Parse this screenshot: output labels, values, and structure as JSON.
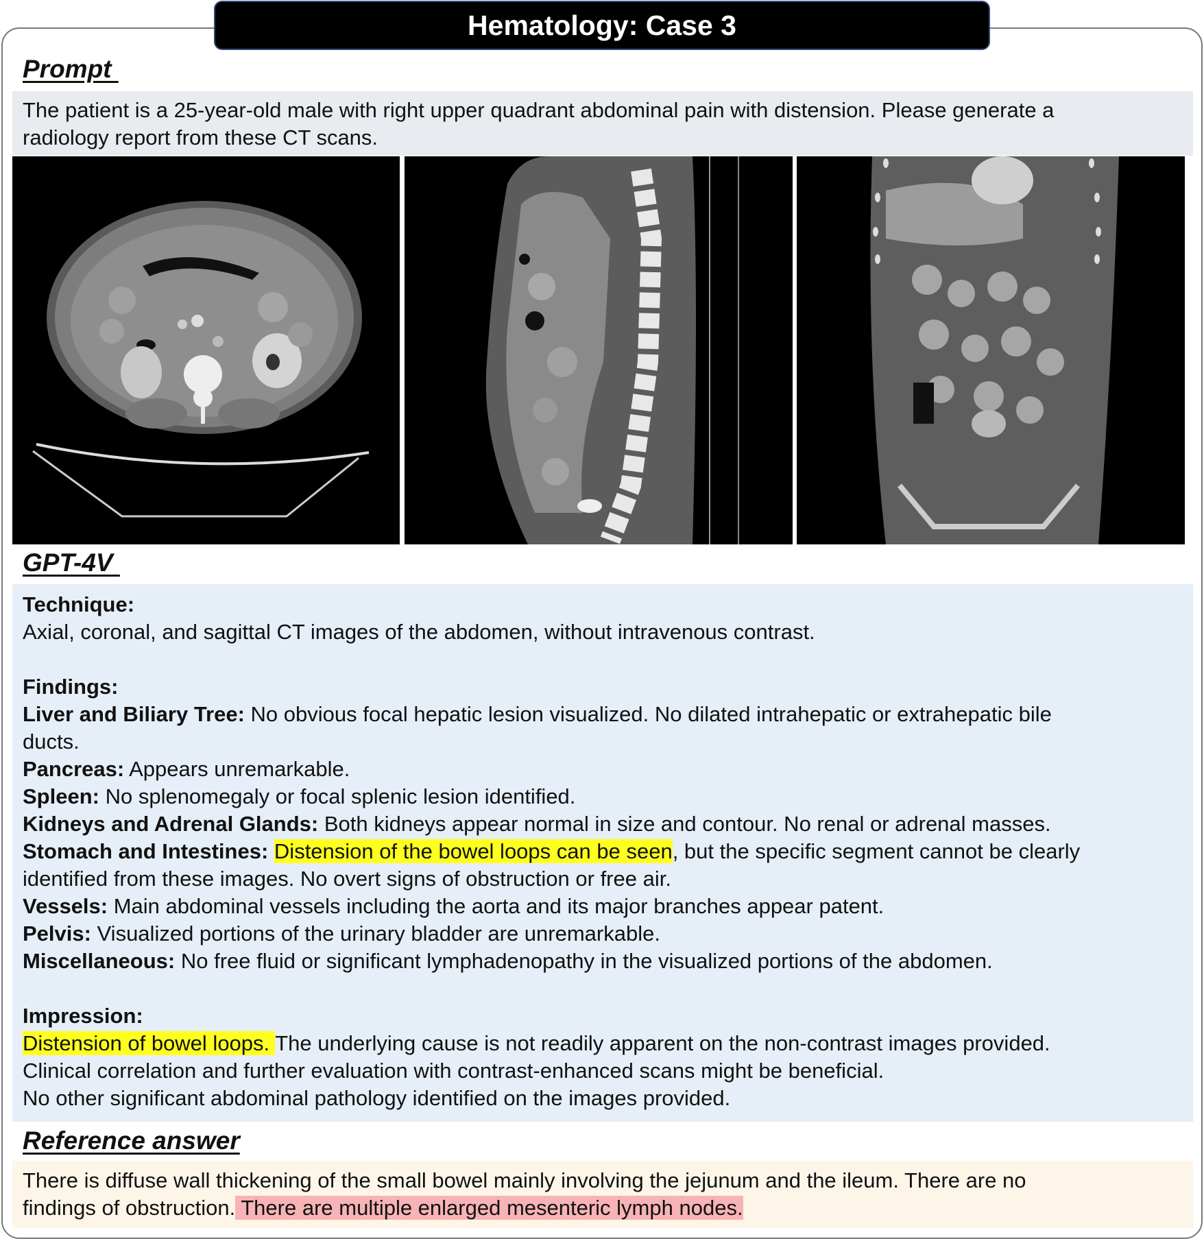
{
  "title": "Hematology: Case 3",
  "prompt": {
    "label": "Prompt ",
    "lines": [
      "The patient is a 25-year-old male with right upper quadrant abdominal pain with distension.  Please generate a",
      "radiology report from these CT scans."
    ]
  },
  "gpt": {
    "label": "GPT-4V ",
    "technique_heading": "Technique:",
    "technique_text": "Axial, coronal, and sagittal CT images of the abdomen, without intravenous contrast.",
    "findings_heading": "Findings:",
    "liver_label": "Liver and Biliary Tree:",
    "liver_text": " No obvious focal hepatic lesion visualized. No dilated intrahepatic or extrahepatic bile",
    "liver_text2": "ducts.",
    "pancreas_label": "Pancreas:",
    "pancreas_text": " Appears unremarkable.",
    "spleen_label": "Spleen:",
    "spleen_text": " No splenomegaly or focal splenic lesion identified.",
    "kidneys_label": "Kidneys and Adrenal Glands:",
    "kidneys_text": " Both kidneys appear normal in size and contour. No renal or adrenal masses.",
    "stomach_label": "Stomach and Intestines:",
    "stomach_highlight": "Distension of the bowel loops can be seen",
    "stomach_text": ", but the specific segment cannot be clearly",
    "stomach_text2": "identified from these images. No overt signs of obstruction or free air.",
    "vessels_label": "Vessels:",
    "vessels_text": " Main abdominal vessels including the aorta and its major branches appear patent.",
    "pelvis_label": "Pelvis:",
    "pelvis_text": " Visualized portions of the urinary bladder are unremarkable.",
    "misc_label": "Miscellaneous:",
    "misc_text": " No free fluid or significant lymphadenopathy in the visualized portions of the abdomen.",
    "impression_heading": "Impression:",
    "impression_highlight": "Distension of bowel loops. ",
    "impression_text": "The underlying cause is not readily apparent on the non-contrast images provided.",
    "impression_text2": "Clinical correlation and further evaluation with contrast-enhanced scans might be beneficial.",
    "impression_text3": "No other significant abdominal pathology identified on the images provided."
  },
  "reference": {
    "label": "Reference answer",
    "line1": "There is diffuse wall thickening of the small bowel mainly involving the jejunum and the ileum. There are no",
    "line2_plain": "findings of obstruction.",
    "line2_highlight": " There are multiple enlarged mesenteric lymph nodes."
  },
  "colors": {
    "highlight_yellow": "#ffff1f",
    "highlight_red": "#f7b3b5",
    "prompt_bg": "#e8ebef",
    "gpt_bg": "#e6eef7",
    "reference_bg": "#fdf5e8"
  }
}
